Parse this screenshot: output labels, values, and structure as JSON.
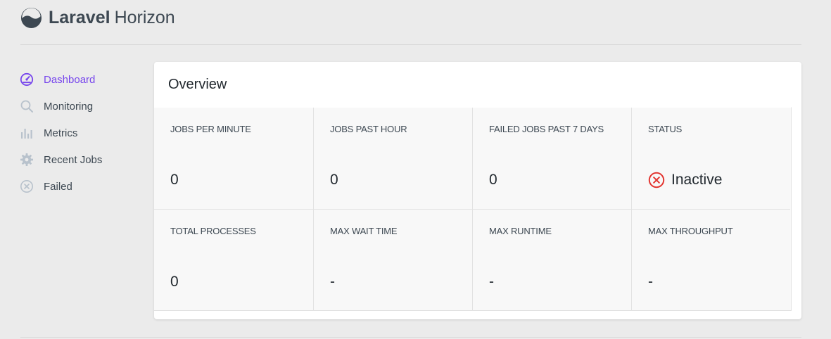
{
  "app": {
    "brand_bold": "Laravel",
    "brand_light": "Horizon"
  },
  "colors": {
    "accent": "#7746ec",
    "danger": "#e3342f",
    "icon_gray": "#b8c2cc",
    "logo_dark": "#3d4852"
  },
  "sidebar": {
    "items": [
      {
        "label": "Dashboard",
        "icon": "dashboard-gauge-icon",
        "active": true
      },
      {
        "label": "Monitoring",
        "icon": "search-icon",
        "active": false
      },
      {
        "label": "Metrics",
        "icon": "bar-chart-icon",
        "active": false
      },
      {
        "label": "Recent Jobs",
        "icon": "gear-icon",
        "active": false
      },
      {
        "label": "Failed",
        "icon": "close-circle-icon",
        "active": false
      }
    ]
  },
  "overview": {
    "title": "Overview",
    "stats": [
      {
        "label": "JOBS PER MINUTE",
        "value": "0"
      },
      {
        "label": "JOBS PAST HOUR",
        "value": "0"
      },
      {
        "label": "FAILED JOBS PAST 7 DAYS",
        "value": "0"
      },
      {
        "label": "STATUS",
        "value": "Inactive",
        "icon": "close-circle-icon"
      },
      {
        "label": "TOTAL PROCESSES",
        "value": "0"
      },
      {
        "label": "MAX WAIT TIME",
        "value": "-"
      },
      {
        "label": "MAX RUNTIME",
        "value": "-"
      },
      {
        "label": "MAX THROUGHPUT",
        "value": "-"
      }
    ]
  }
}
